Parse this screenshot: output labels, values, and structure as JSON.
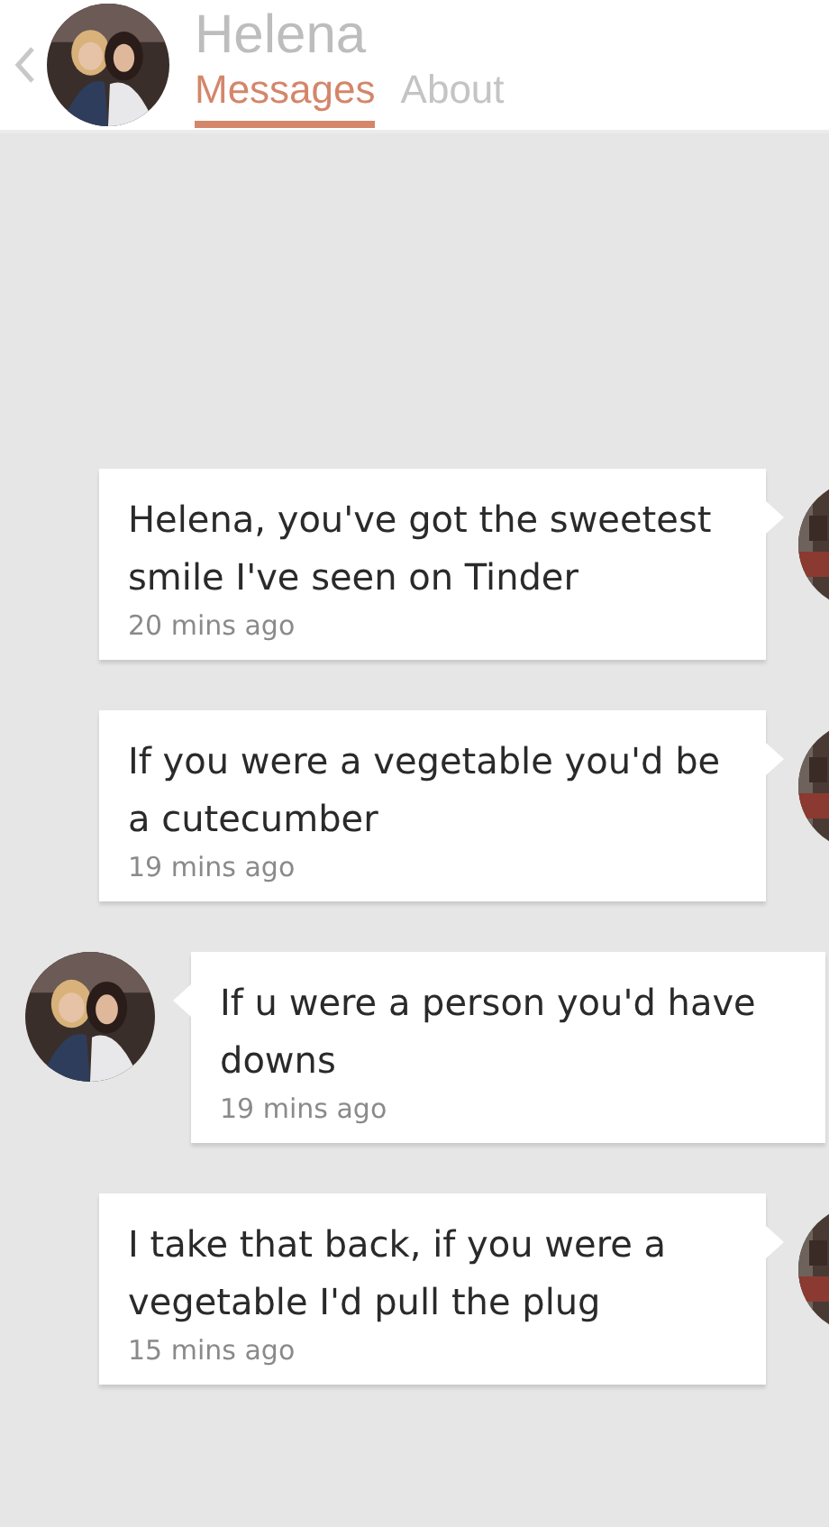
{
  "header": {
    "name": "Helena",
    "tabs": [
      {
        "label": "Messages",
        "selected": true
      },
      {
        "label": "About",
        "selected": false
      }
    ]
  },
  "messages": [
    {
      "kind": "sent",
      "text": "Helena, you've got the sweetest smile I've seen on Tinder",
      "time": "20 mins ago"
    },
    {
      "kind": "sent",
      "text": "If you were a vegetable you'd be a cutecumber",
      "time": "19 mins ago"
    },
    {
      "kind": "received",
      "text": "If u were a person you'd have downs",
      "time": "19 mins ago"
    },
    {
      "kind": "sent",
      "text": "I take that back, if you were a vegetable I'd pull the plug",
      "time": "15 mins ago"
    }
  ]
}
